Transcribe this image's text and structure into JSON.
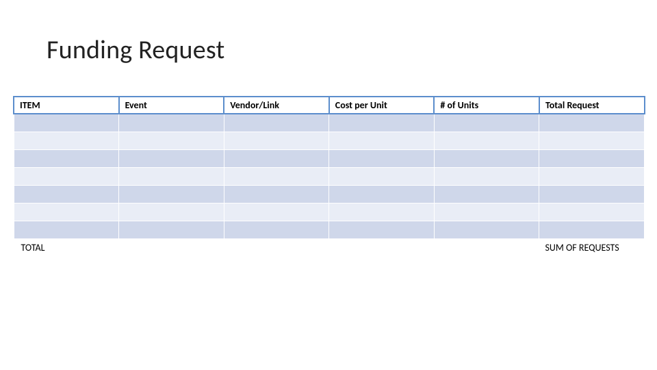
{
  "title": "Funding Request",
  "columns": [
    "ITEM",
    "Event",
    "Vendor/Link",
    "Cost per Unit",
    "# of Units",
    "Total Request"
  ],
  "rows": [
    [
      "",
      "",
      "",
      "",
      "",
      ""
    ],
    [
      "",
      "",
      "",
      "",
      "",
      ""
    ],
    [
      "",
      "",
      "",
      "",
      "",
      ""
    ],
    [
      "",
      "",
      "",
      "",
      "",
      ""
    ],
    [
      "",
      "",
      "",
      "",
      "",
      ""
    ],
    [
      "",
      "",
      "",
      "",
      "",
      ""
    ],
    [
      "",
      "",
      "",
      "",
      "",
      ""
    ]
  ],
  "footer": {
    "label": "TOTAL",
    "c1": "",
    "c2": "",
    "c3": "",
    "c4": "",
    "sum": "SUM OF REQUESTS"
  },
  "chart_data": {
    "type": "table",
    "title": "Funding Request",
    "columns": [
      "ITEM",
      "Event",
      "Vendor/Link",
      "Cost per Unit",
      "# of Units",
      "Total Request"
    ],
    "rows": [
      [
        "",
        "",
        "",
        "",
        "",
        ""
      ],
      [
        "",
        "",
        "",
        "",
        "",
        ""
      ],
      [
        "",
        "",
        "",
        "",
        "",
        ""
      ],
      [
        "",
        "",
        "",
        "",
        "",
        ""
      ],
      [
        "",
        "",
        "",
        "",
        "",
        ""
      ],
      [
        "",
        "",
        "",
        "",
        "",
        ""
      ],
      [
        "",
        "",
        "",
        "",
        "",
        ""
      ]
    ],
    "footer": [
      "TOTAL",
      "",
      "",
      "",
      "",
      "SUM OF REQUESTS"
    ]
  }
}
